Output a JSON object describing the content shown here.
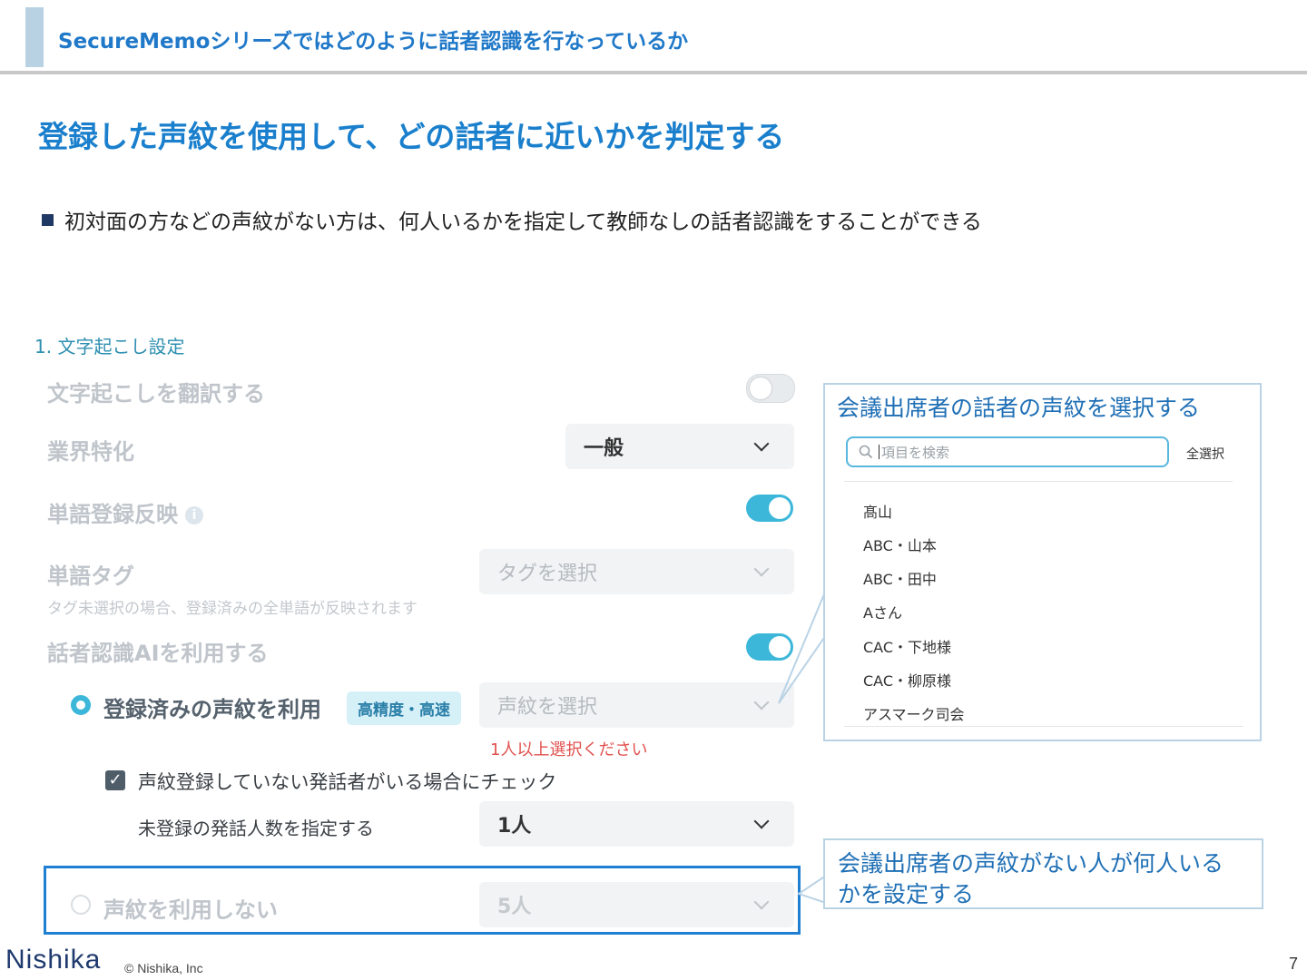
{
  "header": {
    "title": "SecureMemoシリーズではどのように話者認識を行なっているか"
  },
  "slide": {
    "heading": "登録した声紋を使用して、どの話者に近いかを判定する",
    "bullet": "初対面の方などの声紋がない方は、何人いるかを指定して教師なしの話者認識をすることができる"
  },
  "settings": {
    "section_title": "1. 文字起こし設定",
    "translate_label": "文字起こしを翻訳する",
    "translate_on": false,
    "industry_label": "業界特化",
    "industry_value": "一般",
    "dict_label": "単語登録反映",
    "dict_info_icon": "info-icon",
    "dict_on": true,
    "tag_label": "単語タグ",
    "tag_placeholder": "タグを選択",
    "tag_note": "タグ未選択の場合、登録済みの全単語が反映されます",
    "speaker_ai_label": "話者認識AIを利用する",
    "speaker_ai_on": true,
    "registered_option_label": "登録済みの声紋を利用",
    "registered_chip": "高精度・高速",
    "voiceprint_placeholder": "声紋を選択",
    "voiceprint_error": "1人以上選択ください",
    "unregistered_check_label": "声紋登録していない発話者がいる場合にチェック",
    "unregistered_count_label": "未登録の発話人数を指定する",
    "unregistered_count_value": "1人",
    "no_voiceprint_option_label": "声紋を利用しない",
    "no_voiceprint_count_value": "5人"
  },
  "callout_top": {
    "text": "会議出席者の話者の声紋を選択する",
    "search_placeholder": "項目を検索",
    "select_all": "全選択",
    "items": [
      "髙山",
      "ABC・山本",
      "ABC・田中",
      "Aさん",
      "CAC・下地様",
      "CAC・柳原様",
      "アスマーク司会"
    ]
  },
  "callout_bottom": {
    "line1": "会議出席者の声紋がない人が何人いる",
    "line2": "かを設定する"
  },
  "footer": {
    "logo": "Nishika",
    "copyright": "© Nishika, Inc",
    "page_number": "7"
  },
  "colors": {
    "accent": "#1f78c8",
    "toggle_on": "#3cb7d9",
    "highlight_border": "#1f7fd1",
    "error": "#e0524f"
  }
}
